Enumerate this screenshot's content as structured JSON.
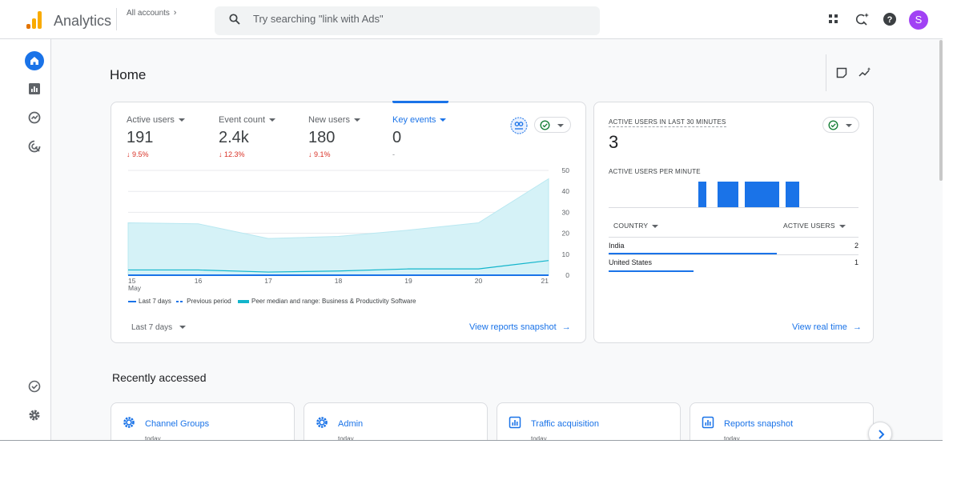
{
  "header": {
    "product": "Analytics",
    "accounts_label": "All accounts",
    "search_placeholder": "Try searching \"link with Ads\"",
    "avatar_initial": "S",
    "icons": [
      "apps-icon",
      "search-insights-icon",
      "help-icon"
    ]
  },
  "nav": {
    "items": [
      "home-icon",
      "reports-icon",
      "explore-icon",
      "advertising-icon"
    ],
    "bottom": [
      "admin-check-icon",
      "settings-gear-icon"
    ]
  },
  "page": {
    "title": "Home"
  },
  "overview": {
    "metrics": [
      {
        "label": "Active users",
        "value": "191",
        "delta": "↓ 9.5%"
      },
      {
        "label": "Event count",
        "value": "2.4k",
        "delta": "↓ 12.3%"
      },
      {
        "label": "New users",
        "value": "180",
        "delta": "↓ 9.1%"
      },
      {
        "label": "Key events",
        "value": "0",
        "delta": "-"
      }
    ],
    "legend": {
      "last7": "Last 7 days",
      "previous": "Previous period",
      "peer": "Peer median and range: Business & Productivity Software"
    },
    "date_range": "Last 7 days",
    "snapshot_link": "View reports snapshot"
  },
  "chart_data": {
    "type": "line",
    "x": [
      "15",
      "16",
      "17",
      "18",
      "19",
      "20",
      "21"
    ],
    "x_sublabel": "May",
    "y_ticks": [
      "0",
      "10",
      "20",
      "30",
      "40",
      "50"
    ],
    "ylim": [
      0,
      50
    ],
    "series": [
      {
        "name": "Last 7 days",
        "values": [
          0,
          0,
          0,
          0,
          0,
          0,
          0
        ]
      },
      {
        "name": "Previous period",
        "values": [
          0,
          0,
          0,
          0,
          0,
          0,
          0
        ]
      },
      {
        "name": "Peer median and range: Business & Productivity Software",
        "values": [
          2.5,
          2.5,
          1.5,
          2,
          3,
          3,
          7
        ],
        "range_low": [
          0,
          0,
          0,
          0,
          0,
          0,
          0
        ],
        "range_high": [
          25,
          24.5,
          17.5,
          18.5,
          21.5,
          25,
          46
        ]
      }
    ],
    "colors": {
      "last7": "#1a73e8",
      "previous": "#1a73e8",
      "peer_line": "#12b5cb",
      "peer_band": "#d5f2f7"
    },
    "grid": true
  },
  "realtime": {
    "title": "ACTIVE USERS IN LAST 30 MINUTES",
    "value": "3",
    "per_minute_label": "ACTIVE USERS PER MINUTE",
    "per_minute_values": [
      1,
      1,
      1,
      1
    ],
    "col_country": "COUNTRY",
    "col_users": "ACTIVE USERS",
    "rows": [
      {
        "country": "India",
        "users": "2",
        "share": 0.67
      },
      {
        "country": "United States",
        "users": "1",
        "share": 0.33
      }
    ],
    "link": "View real time"
  },
  "recent": {
    "title": "Recently accessed",
    "items": [
      {
        "name": "Channel Groups",
        "icon": "gear-icon",
        "when": "today"
      },
      {
        "name": "Admin",
        "icon": "gear-icon",
        "when": "today"
      },
      {
        "name": "Traffic acquisition",
        "icon": "report-icon",
        "when": "today"
      },
      {
        "name": "Reports snapshot",
        "icon": "report-icon",
        "when": "today"
      }
    ]
  }
}
